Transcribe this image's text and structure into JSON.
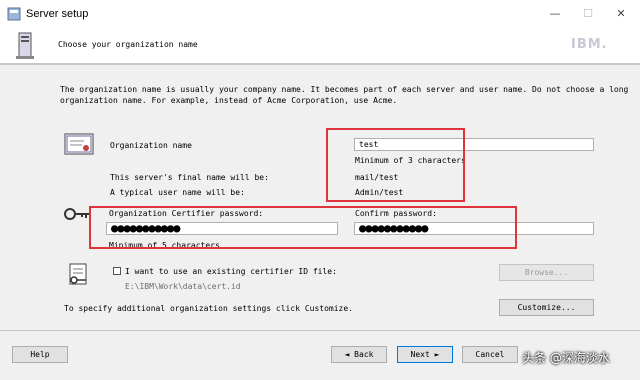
{
  "window": {
    "title": "Server setup",
    "minimize": "—",
    "maximize": "☐",
    "close": "✕"
  },
  "header": {
    "heading": "Choose your organization name",
    "logo": "IBM."
  },
  "intro": {
    "line1": "The organization name is usually your company name. It becomes part of each server and user name. Do not choose a long",
    "line2": "organization name. For example, instead of Acme Corporation, use Acme."
  },
  "org": {
    "label": "Organization name",
    "value": "test",
    "hint": "Minimum of 3 characters",
    "server_name_label": "This server's final name will be:",
    "server_name_value": "mail/test",
    "user_name_label": "A typical user name will be:",
    "user_name_value": "Admin/test"
  },
  "password": {
    "certifier_label": "Organization Certifier password:",
    "certifier_value": "●●●●●●●●●●●",
    "hint": "Minimum of 5 characters",
    "confirm_label": "Confirm password:",
    "confirm_value": "●●●●●●●●●●●"
  },
  "certid": {
    "checkbox_label": "I want to use an existing certifier ID file:",
    "path": "E:\\IBM\\Work\\data\\cert.id",
    "browse": "Browse..."
  },
  "customize": {
    "text": "To specify additional organization settings click Customize.",
    "button": "Customize..."
  },
  "footer": {
    "help": "Help",
    "back": "◄ Back",
    "next": "Next ►",
    "cancel": "Cancel"
  },
  "watermark": "头条 @深海淡水"
}
